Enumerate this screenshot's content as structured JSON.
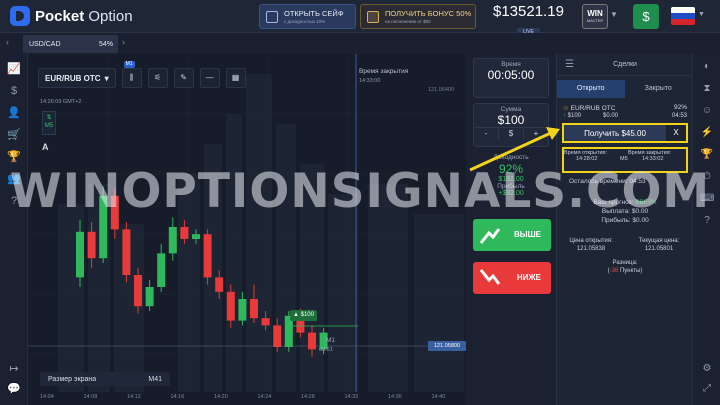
{
  "topbar": {
    "logo_bold": "Pocket",
    "logo_rest": " Option",
    "promo_safe": {
      "title": "ОТКРЫТЬ СЕЙФ",
      "sub": "с доходностью 10%"
    },
    "promo_bonus": {
      "title": "ПОЛУЧИТЬ БОНУС 50%",
      "sub": "на пополнение от $50"
    },
    "balance": "$13521.19",
    "balance_mode": "LIVE",
    "status_title": "WIN",
    "status_level": "МАСТЕР",
    "deposit_symbol": "$",
    "colors": {
      "accent": "#2d6cf0",
      "green": "#2fb85c",
      "red": "#e83a3a",
      "highlight": "#f2d21a"
    }
  },
  "asset_tab": {
    "name": "USD/CAD",
    "payout": "54%"
  },
  "chart": {
    "pair": "EUR/RUB OTC",
    "timeframe_badge": "M1",
    "time_display": "14:26:09 GMT+2",
    "tf_label": "M5",
    "indicator_label": "A",
    "close_label": "Время закрытия",
    "close_time": "14:33:00",
    "price_top": "121.06400",
    "price_current": "121.05800",
    "trade_marker": "$100",
    "m1_label": "M1",
    "m1_time": "00:51",
    "screen_size_label": "Размер экрана",
    "screen_size_value": "M41",
    "x_ticks": [
      "14:04",
      "14:08",
      "14:12",
      "14:16",
      "14:20",
      "14:24",
      "14:28",
      "14:32",
      "14:36",
      "14:40",
      "14:44"
    ]
  },
  "chart_data": {
    "type": "candlestick",
    "candles": [
      {
        "o": 0.26,
        "c": 0.45,
        "h": 0.5,
        "l": 0.22
      },
      {
        "o": 0.45,
        "c": 0.34,
        "h": 0.49,
        "l": 0.3
      },
      {
        "o": 0.34,
        "c": 0.6,
        "h": 0.64,
        "l": 0.32
      },
      {
        "o": 0.6,
        "c": 0.46,
        "h": 0.63,
        "l": 0.42
      },
      {
        "o": 0.46,
        "c": 0.27,
        "h": 0.49,
        "l": 0.24
      },
      {
        "o": 0.27,
        "c": 0.14,
        "h": 0.3,
        "l": 0.11
      },
      {
        "o": 0.14,
        "c": 0.22,
        "h": 0.25,
        "l": 0.12
      },
      {
        "o": 0.22,
        "c": 0.36,
        "h": 0.4,
        "l": 0.2
      },
      {
        "o": 0.36,
        "c": 0.47,
        "h": 0.51,
        "l": 0.33
      },
      {
        "o": 0.47,
        "c": 0.42,
        "h": 0.5,
        "l": 0.4
      },
      {
        "o": 0.42,
        "c": 0.44,
        "h": 0.46,
        "l": 0.4
      },
      {
        "o": 0.44,
        "c": 0.26,
        "h": 0.46,
        "l": 0.23
      },
      {
        "o": 0.26,
        "c": 0.2,
        "h": 0.29,
        "l": 0.17
      },
      {
        "o": 0.2,
        "c": 0.08,
        "h": 0.23,
        "l": 0.05
      },
      {
        "o": 0.08,
        "c": 0.17,
        "h": 0.2,
        "l": 0.06
      },
      {
        "o": 0.17,
        "c": 0.09,
        "h": 0.23,
        "l": 0.07
      },
      {
        "o": 0.09,
        "c": 0.06,
        "h": 0.12,
        "l": 0.04
      },
      {
        "o": 0.06,
        "c": -0.03,
        "h": 0.09,
        "l": -0.05
      },
      {
        "o": -0.03,
        "c": 0.1,
        "h": 0.12,
        "l": -0.05
      },
      {
        "o": 0.1,
        "c": 0.03,
        "h": 0.13,
        "l": 0.01
      },
      {
        "o": 0.03,
        "c": -0.04,
        "h": 0.06,
        "l": -0.07
      },
      {
        "o": -0.04,
        "c": 0.03,
        "h": 0.05,
        "l": -0.06
      }
    ]
  },
  "trade_panel": {
    "time_label": "Время",
    "time_value": "00:05:00",
    "amount_label": "Сумма",
    "amount_value": "$100",
    "minus": "-",
    "currency": "$",
    "plus": "+",
    "payout_label": "Доходность",
    "payout_percent": "92%",
    "payout_amount": "$192.00",
    "profit_label": "Прибыль",
    "profit_amount": "+$92.00",
    "up_label": "ВЫШЕ",
    "down_label": "НИЖЕ"
  },
  "deals": {
    "title": "Сделки",
    "tab_open": "Открыто",
    "tab_closed": "Закрыто",
    "deal_pair": "EUR/RUB OTC",
    "deal_percent": "92%",
    "deal_amount": "$100",
    "deal_change": "$0.00",
    "deal_time": "04:53",
    "sell_label": "Получить $45.00",
    "sell_close": "X",
    "open_time_label": "Время открытия:",
    "open_time": "14:28:02",
    "tf": "M5",
    "close_time_label": "Время закрытия:",
    "close_time": "14:33:02",
    "remaining": "Осталось времени: 04:53",
    "forecast_label": "Ваш прогноз:",
    "forecast_value": "ВВЕРХ",
    "payout_label": "Выплата: $0.00",
    "profit_label": "Прибыль: $0.00",
    "open_price_label": "Цена открытия:",
    "open_price": "121.05838",
    "current_price_label": "Текущая цена:",
    "current_price": "121.05801",
    "diff_label": "Разница:",
    "diff_value": "-38",
    "diff_unit": "Пункты"
  },
  "watermark": "WINOPTIONSIGNALS.COM"
}
